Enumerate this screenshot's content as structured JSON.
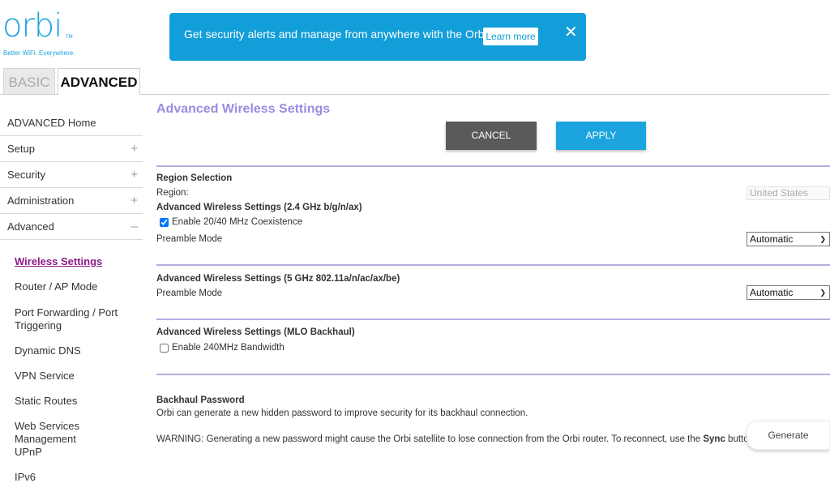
{
  "logo": {
    "text": "orbi",
    "tm": "TM",
    "tagline": "Better WiFi. Everywhere."
  },
  "banner": {
    "message": "Get security alerts and manage from anywhere with the Orbi App.",
    "learn_more": "Learn more",
    "close_icon": "close-icon",
    "color": "#129ed8"
  },
  "tabs": [
    {
      "label": "BASIC",
      "active": false
    },
    {
      "label": "ADVANCED",
      "active": true
    }
  ],
  "sidebar": {
    "items": [
      {
        "label": "ADVANCED Home",
        "expand": ""
      },
      {
        "label": "Setup",
        "expand": "+"
      },
      {
        "label": "Security",
        "expand": "+"
      },
      {
        "label": "Administration",
        "expand": "+"
      },
      {
        "label": "Advanced",
        "expand": "–"
      }
    ],
    "subitems": [
      {
        "label": "Wireless Settings",
        "active": true
      },
      {
        "label": "Router / AP Mode"
      },
      {
        "label": "Port Forwarding / Port Triggering"
      },
      {
        "label": "Dynamic DNS"
      },
      {
        "label": "VPN Service"
      },
      {
        "label": "Static Routes"
      },
      {
        "label": "Web Services Management"
      },
      {
        "label": "UPnP"
      },
      {
        "label": "IPv6"
      }
    ]
  },
  "main": {
    "title": "Advanced Wireless Settings",
    "cancel": "CANCEL",
    "apply": "APPLY",
    "region": {
      "title": "Region Selection",
      "label": "Region:",
      "value": "United States"
    },
    "band24": {
      "title": "Advanced Wireless Settings (2.4 GHz b/g/n/ax)",
      "coexistence": "Enable 20/40 MHz Coexistence",
      "coexistence_checked": true,
      "preamble_label": "Preamble Mode",
      "preamble_value": "Automatic"
    },
    "band5": {
      "title": "Advanced Wireless Settings (5 GHz 802.11a/n/ac/ax/be)",
      "preamble_label": "Preamble Mode",
      "preamble_value": "Automatic"
    },
    "mlo": {
      "title": "Advanced Wireless Settings (MLO Backhaul)",
      "bandwidth": "Enable 240MHz Bandwidth",
      "bandwidth_checked": false
    },
    "backhaul": {
      "title": "Backhaul Password",
      "desc": "Orbi can generate a new hidden password to improve security for its backhaul connection.",
      "warning_pre": "WARNING: Generating a new password might cause the Orbi satellite to lose connection from the Orbi router. To reconnect, use the ",
      "warning_bold": "Sync",
      "warning_post": " button",
      "generate": "Generate"
    }
  },
  "colors": {
    "accent": "#1ba4de",
    "title": "#9a8ce0",
    "active_link": "#8b1b87",
    "divider": "#b5addf"
  }
}
